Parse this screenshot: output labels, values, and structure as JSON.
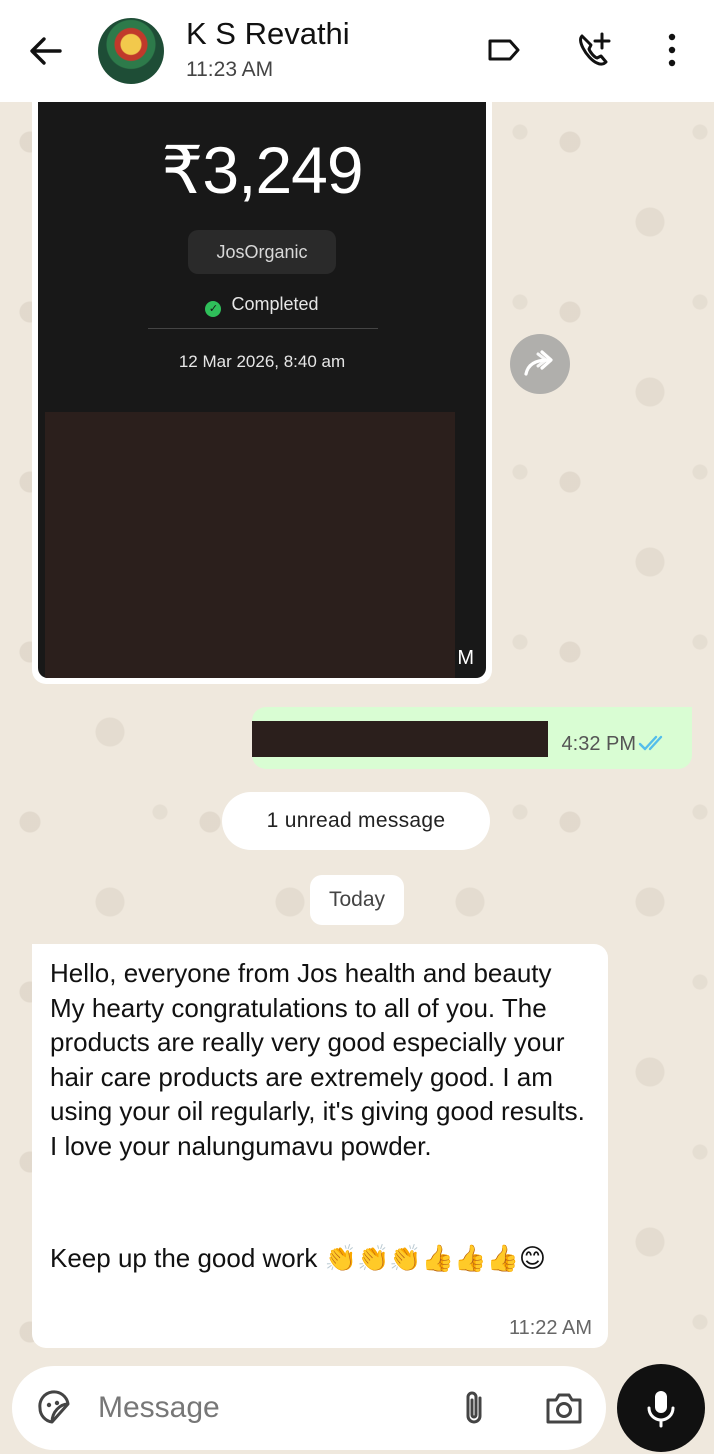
{
  "header": {
    "contact_name": "K S Revathi",
    "last_seen": "11:23 AM",
    "icons": [
      "back-arrow-icon",
      "label-icon",
      "add-call-icon",
      "more-vert-icon"
    ]
  },
  "messages": {
    "image_card": {
      "amount": "₹3,249",
      "merchant": "JosOrganic",
      "status": "Completed",
      "datetime": "12 Mar 2026, 8:40 am",
      "time_fragment": "M"
    },
    "outgoing": {
      "time": "4:32 PM"
    },
    "unread_label": "1 unread message",
    "date_divider": "Today",
    "incoming": {
      "text": "Hello, everyone from Jos health and beauty\nMy hearty congratulations to all of you. The products are really very good especially your hair care products are extremely good. I am using your oil regularly, it's giving good results. I love your nalungumavu powder.",
      "line2": "Keep up the good work 👏👏👏👍👍👍😊",
      "time": "11:22 AM"
    }
  },
  "composer": {
    "placeholder": "Message"
  },
  "colors": {
    "outgoing_bubble": "#d9fdd3",
    "read_ticks": "#53bdeb",
    "completed_green": "#2fbf5a"
  }
}
